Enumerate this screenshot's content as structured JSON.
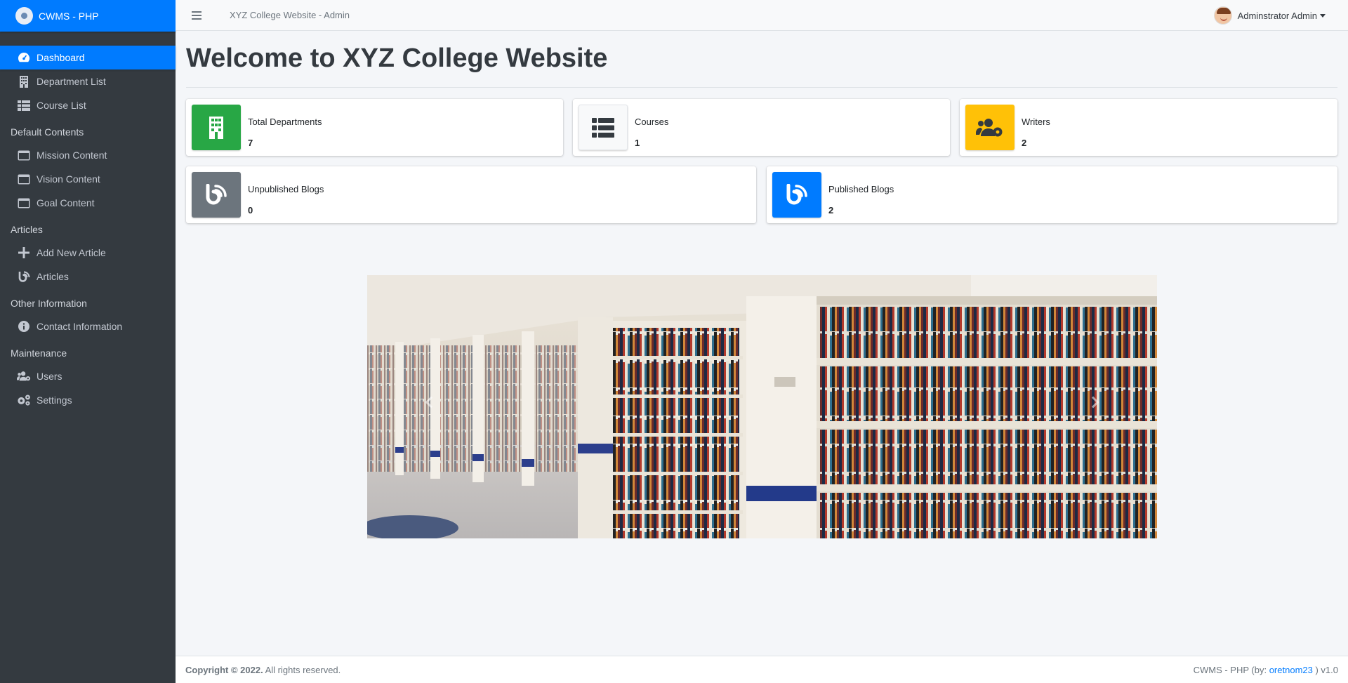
{
  "brand": {
    "name": "CWMS - PHP"
  },
  "topbar": {
    "title": "XYZ College Website - Admin",
    "user": "Adminstrator Admin"
  },
  "sidebar": {
    "items": [
      {
        "label": "Dashboard",
        "icon": "dashboard-icon",
        "active": true
      },
      {
        "label": "Department List",
        "icon": "building-icon"
      },
      {
        "label": "Course List",
        "icon": "table-list-icon"
      }
    ],
    "sections": [
      {
        "header": "Default Contents",
        "items": [
          {
            "label": "Mission Content",
            "icon": "window-icon"
          },
          {
            "label": "Vision Content",
            "icon": "window-icon"
          },
          {
            "label": "Goal Content",
            "icon": "window-icon"
          }
        ]
      },
      {
        "header": "Articles",
        "items": [
          {
            "label": "Add New Article",
            "icon": "plus-icon"
          },
          {
            "label": "Articles",
            "icon": "blog-icon"
          }
        ]
      },
      {
        "header": "Other Information",
        "items": [
          {
            "label": "Contact Information",
            "icon": "info-circle-icon"
          }
        ]
      },
      {
        "header": "Maintenance",
        "items": [
          {
            "label": "Users",
            "icon": "users-cog-icon"
          },
          {
            "label": "Settings",
            "icon": "cogs-icon"
          }
        ]
      }
    ]
  },
  "main": {
    "title": "Welcome to XYZ College Website",
    "stats": [
      {
        "label": "Total Departments",
        "value": "7",
        "color": "#28a745",
        "icon": "building-icon"
      },
      {
        "label": "Courses",
        "value": "1",
        "color": "#f8f9fa",
        "icon": "list-icon"
      },
      {
        "label": "Writers",
        "value": "2",
        "color": "#ffc107",
        "icon": "users-cog-icon"
      },
      {
        "label": "Unpublished Blogs",
        "value": "0",
        "color": "#6c757d",
        "icon": "blog-icon"
      },
      {
        "label": "Published Blogs",
        "value": "2",
        "color": "#007bff",
        "icon": "blog-icon"
      }
    ]
  },
  "footer": {
    "copyright": "Copyright © 2022.",
    "rights": "All rights reserved.",
    "credit_prefix": "CWMS - PHP (by:",
    "credit_author": "oretnom23",
    "credit_suffix": ") v1.0"
  }
}
